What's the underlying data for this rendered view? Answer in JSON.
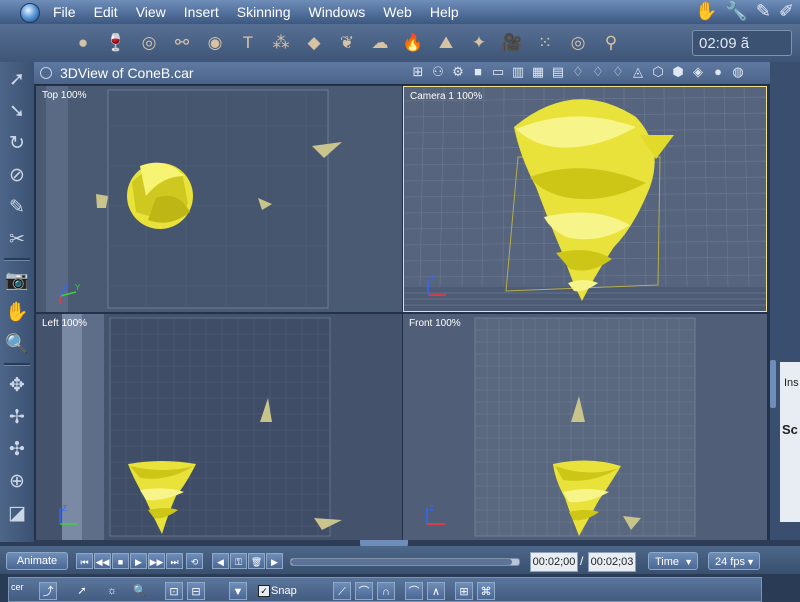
{
  "menubar": {
    "items": [
      "File",
      "Edit",
      "View",
      "Insert",
      "Skinning",
      "Windows",
      "Web",
      "Help"
    ]
  },
  "toolbar": {
    "clock": "02:09 ã"
  },
  "document": {
    "title": "3DView of ConeB.car"
  },
  "viewports": {
    "top": {
      "label": "Top 100%"
    },
    "camera": {
      "label": "Camera 1 100%"
    },
    "left": {
      "label": "Left 100%"
    },
    "front": {
      "label": "Front 100%"
    }
  },
  "timeline": {
    "animate_label": "Animate",
    "current_time": "00:02;00",
    "end_time": "00:02;03",
    "format": "Time",
    "fps": "24 fps",
    "progress": 0.97
  },
  "bottombar": {
    "snap_label": "Snap",
    "snap_checked": true
  },
  "rightpanel": {
    "tab1": "Ins",
    "tab2": "Sc"
  },
  "colors": {
    "model_yellow": "#f4ec2a",
    "viewport_bg": "#4a5972",
    "camera_bg": "#535f78",
    "ui_blue": "#4f6d98",
    "selection_border": "#f1e28b"
  }
}
